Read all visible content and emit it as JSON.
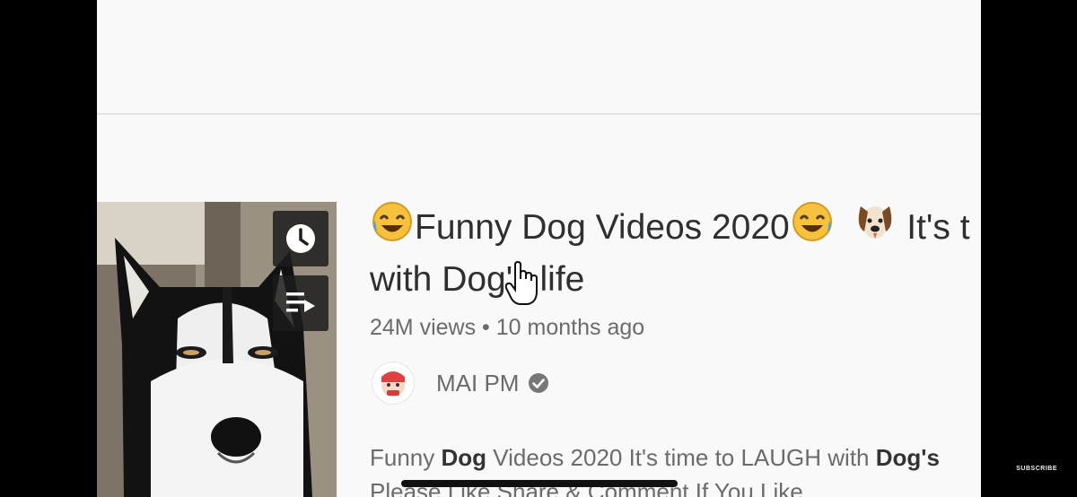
{
  "video": {
    "title_line1": "Funny Dog Videos 2020",
    "title_line1_tail": "It's t",
    "title_line2": "with Dog's life",
    "views": "24M views",
    "separator": "•",
    "age": "10 months ago",
    "channel_name": "MAI PM",
    "description_pre": "Funny ",
    "description_bold": "Dog",
    "description_mid": " Videos 2020 It's time to LAUGH with ",
    "description_bold2": "Dog's",
    "description_line2": "Please Like Share & Comment If You Like..."
  },
  "thumbnail_buttons": {
    "watch_later_icon": "clock-icon",
    "add_to_queue_icon": "queue-icon"
  },
  "overlay": {
    "watermark": "SUBSCRIBE"
  },
  "colors": {
    "page_bg": "#f9f9f9",
    "title_text": "#2f2f2f",
    "meta_text": "#6b6b6b"
  }
}
